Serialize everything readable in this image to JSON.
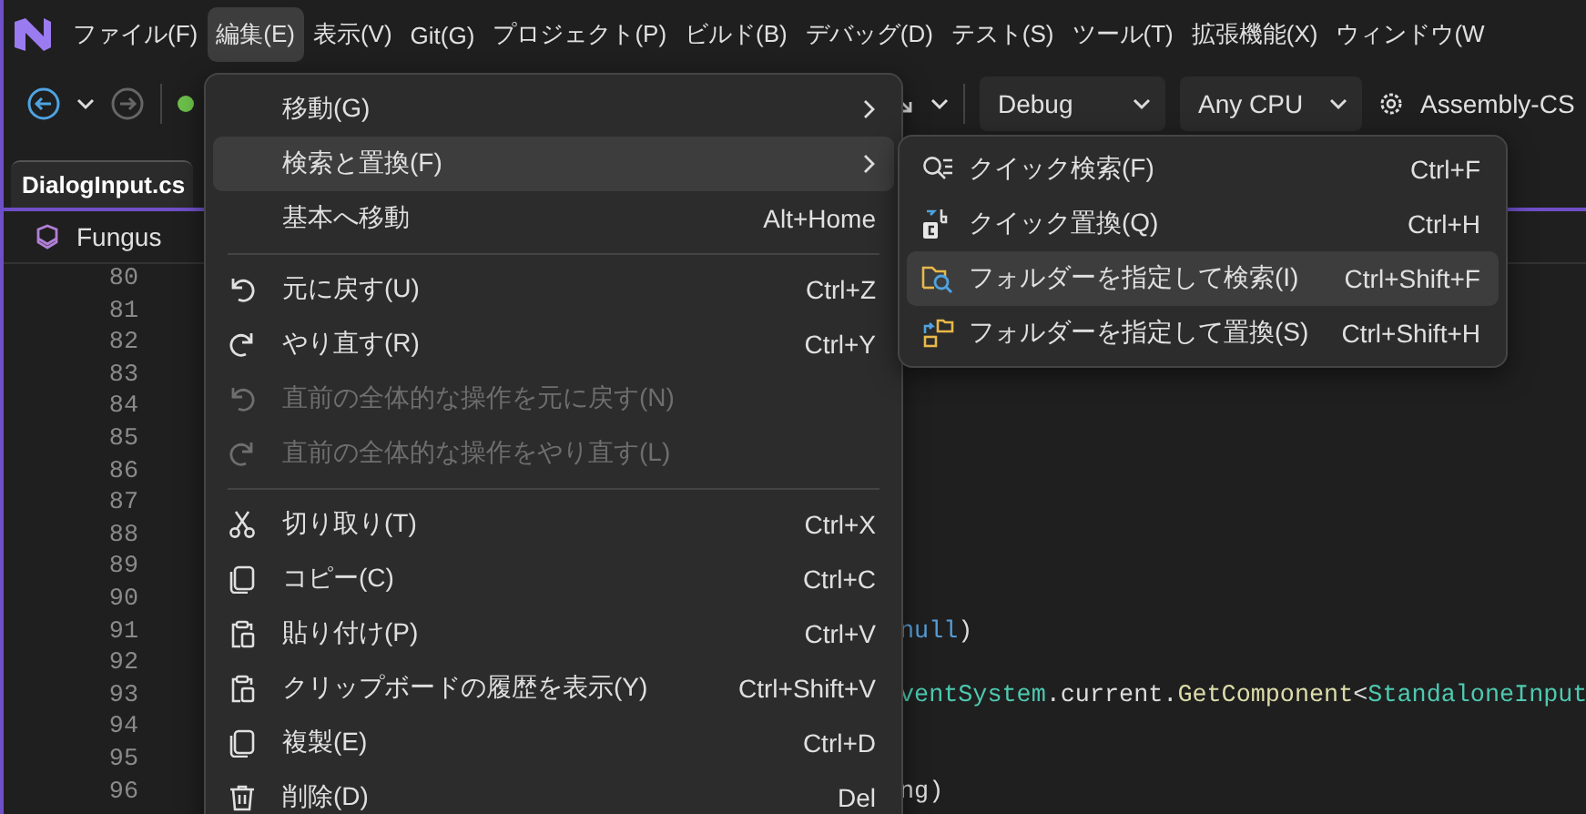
{
  "menubar": [
    {
      "label": "ファイル(F)",
      "selected": false
    },
    {
      "label": "編集(E)",
      "selected": true
    },
    {
      "label": "表示(V)",
      "selected": false
    },
    {
      "label": "Git(G)",
      "selected": false
    },
    {
      "label": "プロジェクト(P)",
      "selected": false
    },
    {
      "label": "ビルド(B)",
      "selected": false
    },
    {
      "label": "デバッグ(D)",
      "selected": false
    },
    {
      "label": "テスト(S)",
      "selected": false
    },
    {
      "label": "ツール(T)",
      "selected": false
    },
    {
      "label": "拡張機能(X)",
      "selected": false
    },
    {
      "label": "ウィンドウ(W",
      "selected": false
    }
  ],
  "toolbar": {
    "configuration": "Debug",
    "platform": "Any CPU",
    "startup": "Assembly-CS"
  },
  "tab": {
    "label": "DialogInput.cs"
  },
  "breadcrumb": {
    "label": "Fungus"
  },
  "editor": {
    "lines": [
      {
        "number": "80"
      },
      {
        "number": "81"
      },
      {
        "number": "82"
      },
      {
        "number": "83"
      },
      {
        "number": "84"
      },
      {
        "number": "85"
      },
      {
        "number": "86"
      },
      {
        "number": "87"
      },
      {
        "number": "88"
      },
      {
        "number": "89"
      },
      {
        "number": "90"
      },
      {
        "number": "91",
        "tokens": [
          {
            "text": "null",
            "kind": "keyword"
          },
          {
            "text": ")",
            "kind": "plain"
          }
        ]
      },
      {
        "number": "92"
      },
      {
        "number": "93",
        "tokens": [
          {
            "text": "ventSystem",
            "kind": "type"
          },
          {
            "text": ".current.",
            "kind": "plain"
          },
          {
            "text": "GetComponent",
            "kind": "method"
          },
          {
            "text": "<",
            "kind": "plain"
          },
          {
            "text": "StandaloneInput",
            "kind": "type"
          }
        ]
      },
      {
        "number": "94"
      },
      {
        "number": "95"
      },
      {
        "number": "96",
        "tokens": [
          {
            "text": "ng)",
            "kind": "plain"
          }
        ]
      }
    ]
  },
  "edit_menu": {
    "items": [
      {
        "kind": "item",
        "label": "移動(G)",
        "submenu": true,
        "disabled": false,
        "selected": false
      },
      {
        "kind": "item",
        "label": "検索と置換(F)",
        "submenu": true,
        "disabled": false,
        "selected": true
      },
      {
        "kind": "item",
        "label": "基本へ移動",
        "shortcut": "Alt+Home",
        "submenu": false,
        "disabled": false,
        "selected": false
      },
      {
        "kind": "separator"
      },
      {
        "kind": "item",
        "label": "元に戻す(U)",
        "shortcut": "Ctrl+Z",
        "submenu": false,
        "disabled": false,
        "selected": false
      },
      {
        "kind": "item",
        "label": "やり直す(R)",
        "shortcut": "Ctrl+Y",
        "submenu": false,
        "disabled": false,
        "selected": false
      },
      {
        "kind": "item",
        "label": "直前の全体的な操作を元に戻す(N)",
        "submenu": false,
        "disabled": true,
        "selected": false
      },
      {
        "kind": "item",
        "label": "直前の全体的な操作をやり直す(L)",
        "submenu": false,
        "disabled": true,
        "selected": false
      },
      {
        "kind": "separator"
      },
      {
        "kind": "item",
        "label": "切り取り(T)",
        "shortcut": "Ctrl+X",
        "submenu": false,
        "disabled": false,
        "selected": false
      },
      {
        "kind": "item",
        "label": "コピー(C)",
        "shortcut": "Ctrl+C",
        "submenu": false,
        "disabled": false,
        "selected": false
      },
      {
        "kind": "item",
        "label": "貼り付け(P)",
        "shortcut": "Ctrl+V",
        "submenu": false,
        "disabled": false,
        "selected": false
      },
      {
        "kind": "item",
        "label": "クリップボードの履歴を表示(Y)",
        "shortcut": "Ctrl+Shift+V",
        "submenu": false,
        "disabled": false,
        "selected": false
      },
      {
        "kind": "item",
        "label": "複製(E)",
        "shortcut": "Ctrl+D",
        "submenu": false,
        "disabled": false,
        "selected": false
      },
      {
        "kind": "item",
        "label": "削除(D)",
        "shortcut": "Del",
        "submenu": false,
        "disabled": false,
        "selected": false
      }
    ]
  },
  "find_submenu": {
    "items": [
      {
        "label": "クイック検索(F)",
        "shortcut": "Ctrl+F",
        "selected": false
      },
      {
        "label": "クイック置換(Q)",
        "shortcut": "Ctrl+H",
        "selected": false
      },
      {
        "label": "フォルダーを指定して検索(I)",
        "shortcut": "Ctrl+Shift+F",
        "selected": true
      },
      {
        "label": "フォルダーを指定して置換(S)",
        "shortcut": "Ctrl+Shift+H",
        "selected": false
      }
    ]
  }
}
